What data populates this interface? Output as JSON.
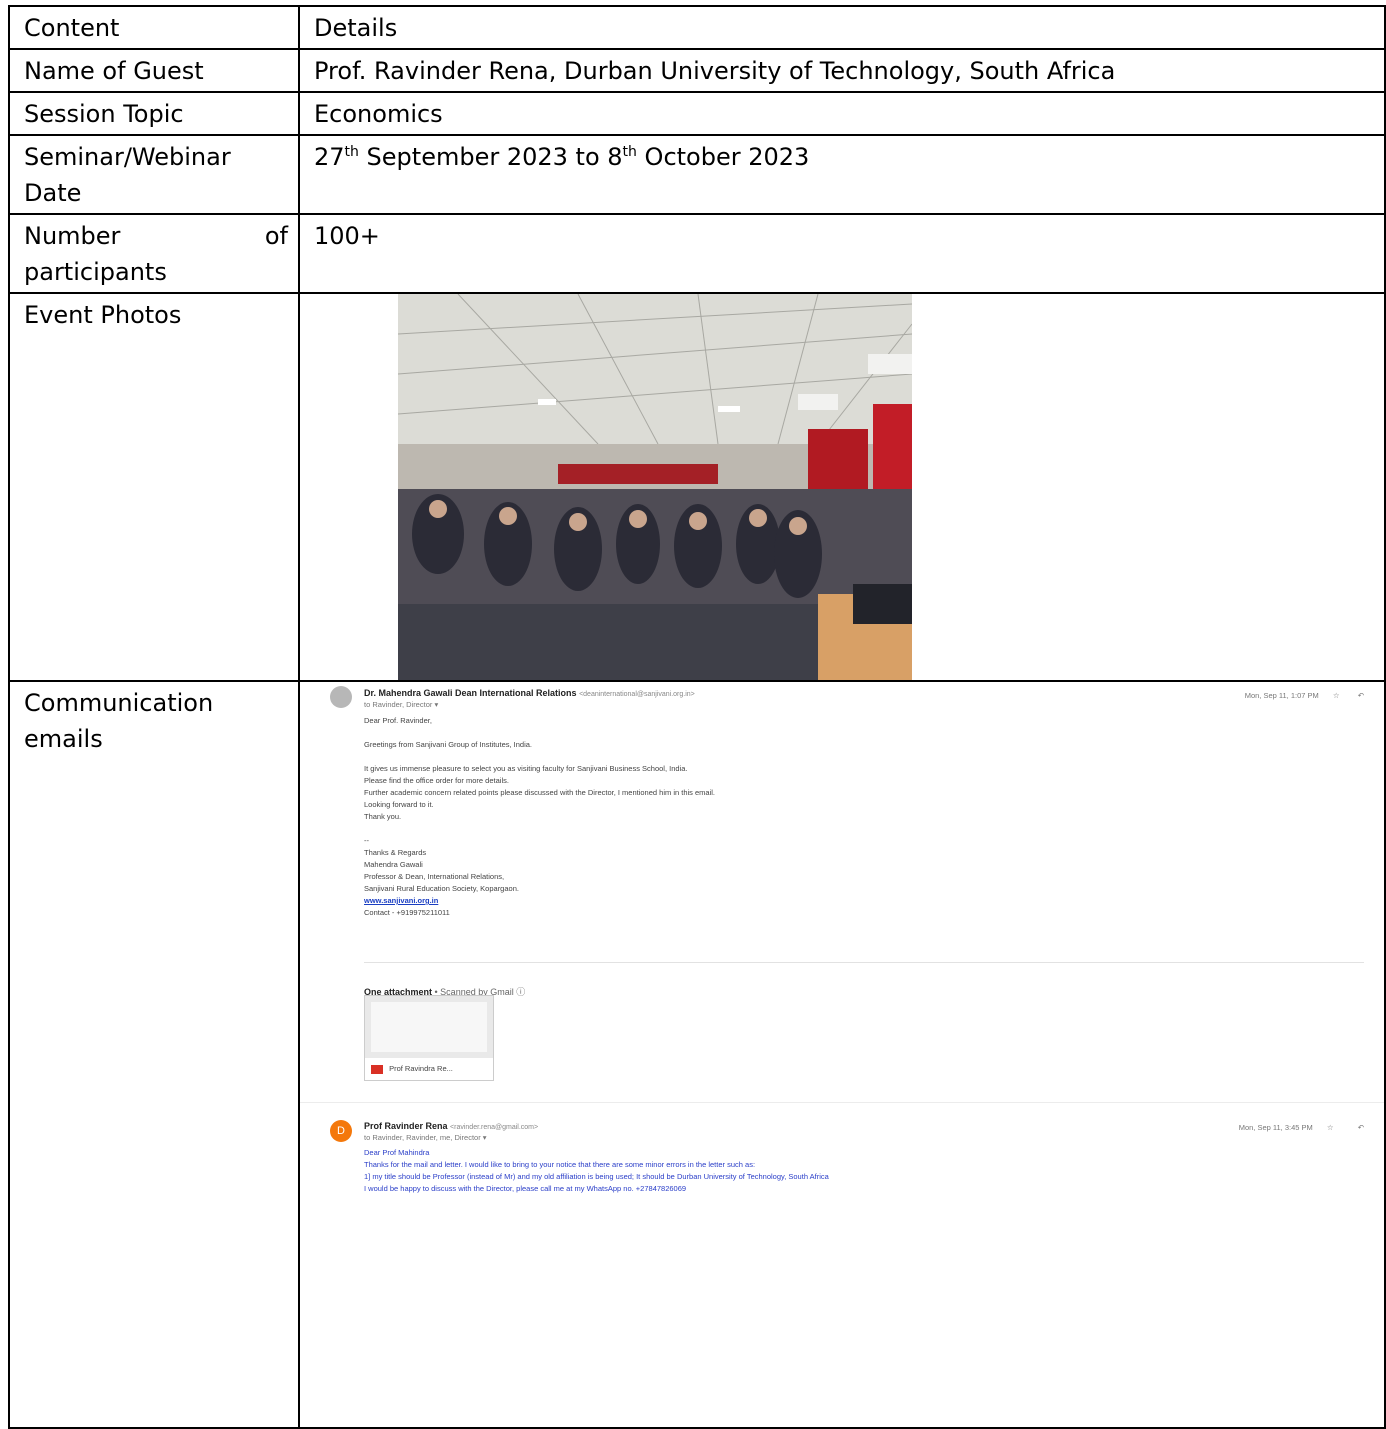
{
  "table": {
    "header": {
      "label": "Content",
      "value": "Details"
    },
    "guest": {
      "label": "Name of Guest",
      "value": "Prof. Ravinder Rena, Durban University of Technology, South Africa"
    },
    "topic": {
      "label": "Session Topic",
      "value": "Economics"
    },
    "date": {
      "label": "Seminar/Webinar Date",
      "d1": "27",
      "s1": "th",
      "m1": " September 2023 to 8",
      "s2": "th",
      "m2": " October 2023"
    },
    "participants": {
      "label_1": "Number of",
      "label_2": "participants",
      "value": "100+"
    },
    "photos": {
      "label": "Event Photos"
    },
    "emails": {
      "label": "Communication emails"
    }
  },
  "email1": {
    "sender": "Dr. Mahendra Gawali Dean International Relations",
    "sender_addr": "<deaninternational@sanjivani.org.in>",
    "to": "to Ravinder, Director ▾",
    "time": "Mon, Sep 11, 1:07 PM",
    "body": [
      "Dear Prof. Ravinder,",
      "",
      "Greetings from Sanjivani Group of Institutes, India.",
      "",
      "It gives us immense pleasure to select you as visiting faculty for Sanjivani Business School, India.",
      "Please find the office order for more details.",
      "Further academic concern related points please discussed with the Director, I mentioned him in this email.",
      "Looking forward to it.",
      "Thank you.",
      "",
      "--",
      "Thanks & Regards",
      "Mahendra Gawali",
      "Professor & Dean, International Relations,",
      "Sanjivani Rural Education Society, Kopargaon."
    ],
    "link": "www.sanjivani.org.in",
    "contact": "Contact - +919975211011",
    "attachment_title": "One attachment",
    "attachment_note": "• Scanned by Gmail ⓘ",
    "attachment_name": "Prof Ravindra Re..."
  },
  "email2": {
    "avatar": "D",
    "sender": "Prof Ravinder Rena",
    "sender_addr": "<ravinder.rena@gmail.com>",
    "to": "to Ravinder, Ravinder, me, Director ▾",
    "time": "Mon, Sep 11, 3:45 PM",
    "body": [
      "Dear Prof Mahindra",
      "Thanks for the mail and letter. I would like to bring to your notice that there are some minor errors in the letter such as:",
      "1] my title should be Professor (instead of Mr) and my old affiliation is being used; It should be Durban University of Technology, South Africa",
      "I would be happy to discuss with the Director, please call me at my WhatsApp no. +27847826069"
    ]
  }
}
